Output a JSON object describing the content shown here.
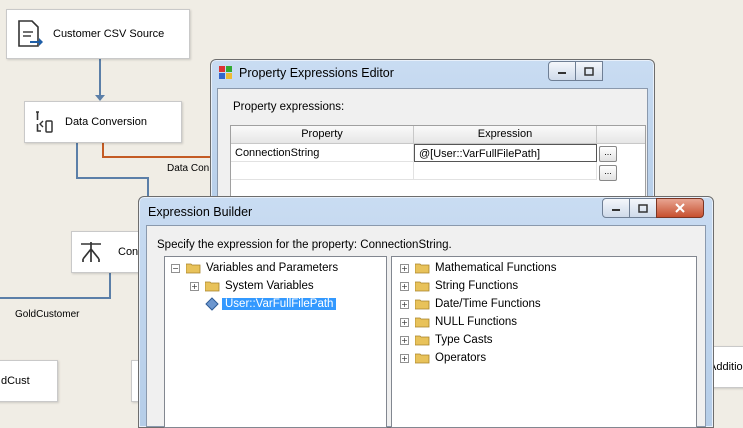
{
  "canvas": {
    "nodes": [
      {
        "label": "Customer CSV Source",
        "icon": "flat-file-source-icon"
      },
      {
        "label": "Data Conversion",
        "icon": "data-conversion-icon"
      },
      {
        "label": "Con",
        "icon": "conditional-split-icon"
      },
      {
        "label": "dCust"
      },
      {
        "label": "Additiona"
      }
    ],
    "path_labels": {
      "data_conv": "Data Con",
      "gold_customer": "GoldCustomer"
    },
    "colors": {
      "arrow_blue": "#5b7fa8",
      "arrow_error": "#c45b24"
    }
  },
  "property_editor": {
    "title": "Property Expressions Editor",
    "section_label": "Property expressions:",
    "columns": [
      "Property",
      "Expression"
    ],
    "rows": [
      {
        "property": "ConnectionString",
        "expression": "@[User::VarFullFilePath]",
        "button": "..."
      },
      {
        "property": "",
        "expression": "",
        "button": "..."
      }
    ]
  },
  "expression_builder": {
    "title": "Expression Builder",
    "instruction": "Specify the expression for the property: ConnectionString.",
    "variables_tree": {
      "root": "Variables and Parameters",
      "system": "System Variables",
      "selected": "User::VarFullFilePath"
    },
    "functions_tree": [
      "Mathematical Functions",
      "String Functions",
      "Date/Time Functions",
      "NULL Functions",
      "Type Casts",
      "Operators"
    ]
  }
}
